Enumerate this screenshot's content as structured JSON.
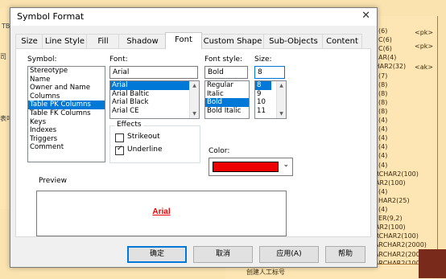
{
  "background": {
    "left_table_tag": "TB_",
    "left_rows": [
      "司",
      "表叫"
    ],
    "right_rows": [
      "(6)",
      "C(6)",
      "C(6)",
      "AR(4)",
      "CHAR2(32)",
      "(7)",
      "(8)",
      "(8)",
      "(8)",
      "(8)",
      "(4)",
      "(4)",
      "(4)",
      "(4)",
      "(4)",
      "(4)",
      "ARCHAR2(100)",
      "HAR2(100)",
      "(4)",
      "HAR2(25)",
      "(4)",
      "ER(9,2)",
      "HAR2(100)",
      "ARCHAR2(100)",
      "VARCHAR2(2000)",
      "VARCHAR2(2000)",
      "VARCHAR2(100)"
    ],
    "pk_tags": [
      "<pk>",
      "<pk>",
      "<ak>"
    ],
    "bottom_text": "创建人工标号"
  },
  "dialog": {
    "title": "Symbol Format",
    "close_glyph": "✕",
    "tabs": [
      "Size",
      "Line Style",
      "Fill",
      "Shadow",
      "Font",
      "Custom Shape",
      "Sub-Objects",
      "Content"
    ],
    "active_tab": "Font",
    "symbol_label": "Symbol:",
    "symbols": [
      "Stereotype",
      "Name",
      "Owner and Name",
      "Columns",
      "Table PK Columns",
      "Table FK Columns",
      "Keys",
      "Indexes",
      "Triggers",
      "Comment"
    ],
    "selected_symbol": "Table PK Columns",
    "font_label": "Font:",
    "font_value": "Arial",
    "fonts": [
      "Arial",
      "Arial Baltic",
      "Arial Black",
      "Arial CE"
    ],
    "selected_font": "Arial",
    "style_label": "Font style:",
    "style_value": "Bold",
    "styles": [
      "Regular",
      "Italic",
      "Bold",
      "Bold Italic"
    ],
    "selected_style": "Bold",
    "size_label": "Size:",
    "size_value": "8",
    "sizes": [
      "8",
      "9",
      "10",
      "11"
    ],
    "selected_size": "8",
    "effects_label": "Effects",
    "strikeout_label": "Strikeout",
    "underline_label": "Underline",
    "underline_checked": true,
    "color_label": "Color:",
    "color_value": "#ef0000",
    "preview_label": "Preview",
    "preview_text": "Arial",
    "buttons": {
      "ok": "确定",
      "cancel": "取消",
      "apply": "应用(A)",
      "help": "帮助"
    }
  }
}
